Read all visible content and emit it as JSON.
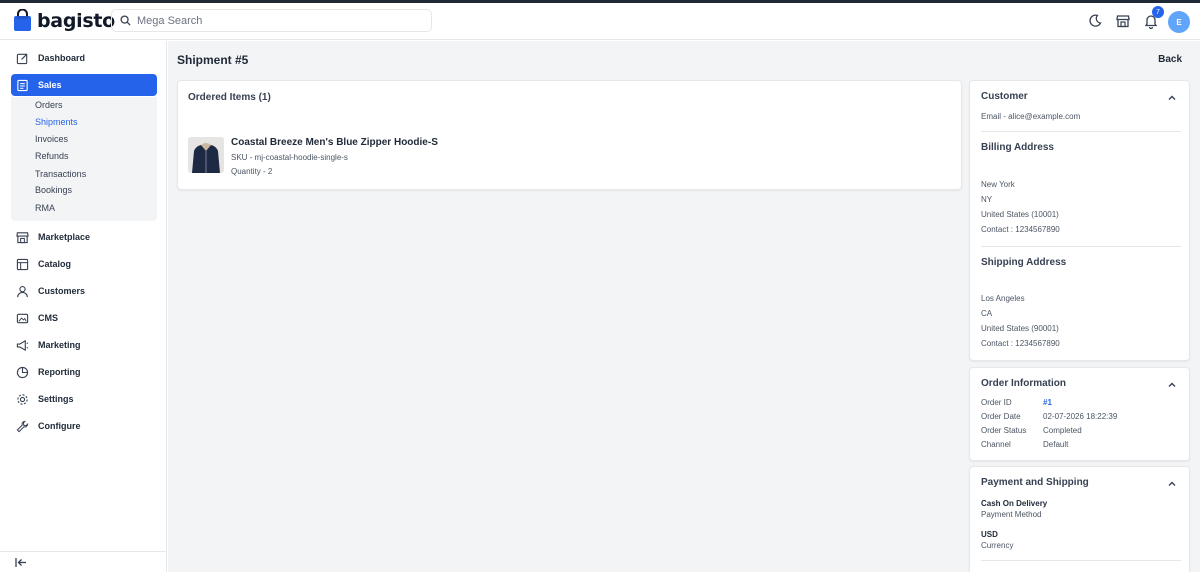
{
  "brand": {
    "name": "bagisto",
    "color": "#2563eb"
  },
  "search": {
    "placeholder": "Mega Search"
  },
  "header": {
    "notification_count": "7",
    "avatar_initial": "E"
  },
  "sidebar": {
    "items": [
      {
        "label": "Dashboard",
        "icon": "dashboard-icon"
      },
      {
        "label": "Sales",
        "icon": "sales-icon",
        "active": true
      },
      {
        "label": "Marketplace",
        "icon": "marketplace-icon"
      },
      {
        "label": "Catalog",
        "icon": "catalog-icon"
      },
      {
        "label": "Customers",
        "icon": "customers-icon"
      },
      {
        "label": "CMS",
        "icon": "cms-icon"
      },
      {
        "label": "Marketing",
        "icon": "marketing-icon"
      },
      {
        "label": "Reporting",
        "icon": "reporting-icon"
      },
      {
        "label": "Settings",
        "icon": "settings-icon"
      },
      {
        "label": "Configure",
        "icon": "configure-icon"
      }
    ],
    "sales_submenu": [
      "Orders",
      "Shipments",
      "Invoices",
      "Refunds",
      "Transactions",
      "Bookings",
      "RMA"
    ],
    "active_submenu": "Shipments"
  },
  "page": {
    "title": "Shipment #5",
    "back_label": "Back"
  },
  "ordered_items": {
    "title": "Ordered Items (1)",
    "item": {
      "name": "Coastal Breeze Men's Blue Zipper Hoodie-S",
      "sku": "SKU - mj-coastal-hoodie-single-s",
      "quantity": "Quantity - 2"
    }
  },
  "customer": {
    "title": "Customer",
    "email": "Email - alice@example.com",
    "billing_title": "Billing Address",
    "billing": [
      "New York",
      "NY",
      "United States (10001)",
      "Contact : 1234567890"
    ],
    "shipping_title": "Shipping Address",
    "shipping": [
      "Los Angeles",
      "CA",
      "United States (90001)",
      "Contact : 1234567890"
    ]
  },
  "order_info": {
    "title": "Order Information",
    "rows": [
      {
        "key": "Order ID",
        "value": "#1"
      },
      {
        "key": "Order Date",
        "value": "02-07-2026 18:22:39"
      },
      {
        "key": "Order Status",
        "value": "Completed"
      },
      {
        "key": "Channel",
        "value": "Default"
      }
    ]
  },
  "payment": {
    "title": "Payment and Shipping",
    "method_value": "Cash On Delivery",
    "method_label": "Payment Method",
    "currency_value": "USD",
    "currency_label": "Currency"
  }
}
